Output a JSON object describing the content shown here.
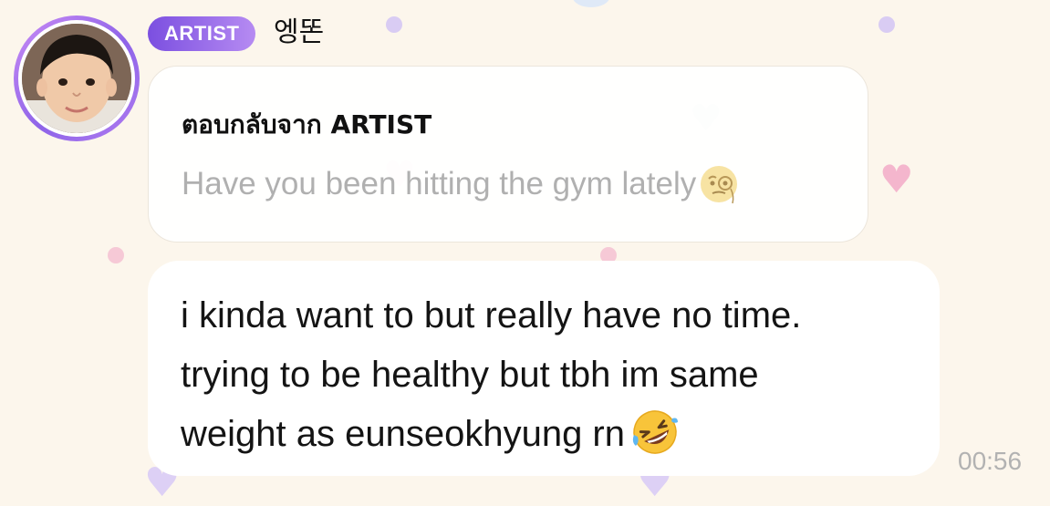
{
  "sender": {
    "badge": "ARTIST",
    "name": "엥똔"
  },
  "reply": {
    "label": "ตอบกลับจาก ARTIST",
    "quote": "Have you been hitting the gym lately",
    "quote_emoji": "face-with-monocle-icon"
  },
  "message": {
    "lines": [
      "i kinda want to but really have no time.",
      "trying to be healthy but tbh im same",
      "weight as eunseokhyung rn"
    ],
    "end_emoji": "rolling-on-the-floor-laughing-icon"
  },
  "timestamp": "00:56",
  "colors": {
    "badge_start": "#7b4fe0",
    "badge_end": "#b68bf2",
    "background": "#fcf6ec",
    "quote_text": "#b0b0b0"
  }
}
